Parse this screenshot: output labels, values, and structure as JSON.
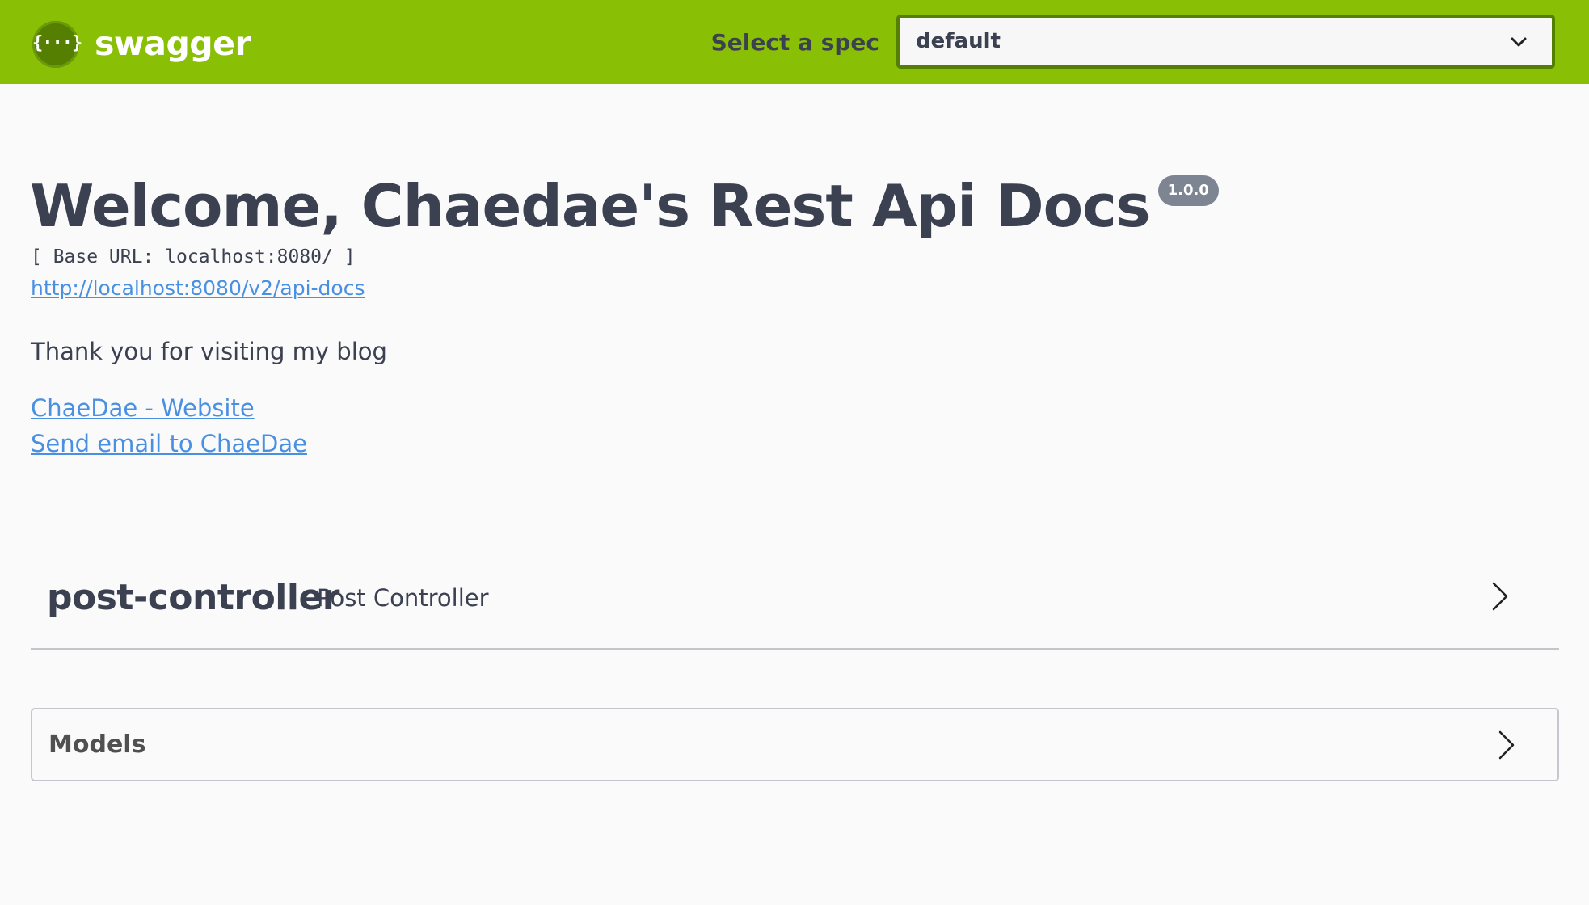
{
  "topbar": {
    "logo_glyph": "{···}",
    "logo_text": "swagger",
    "spec_label": "Select a spec",
    "spec_selected": "default",
    "colors": {
      "bar": "#89bf04",
      "select_border": "#547f00"
    }
  },
  "info": {
    "title": "Welcome, Chaedae's Rest Api Docs",
    "version": "1.0.0",
    "base_url": "[ Base URL: localhost:8080/ ]",
    "api_docs_link": "http://localhost:8080/v2/api-docs",
    "description": "Thank you for visiting my blog",
    "website_link": "ChaeDae - Website",
    "email_link": "Send email to ChaeDae",
    "link_color": "#4990e2"
  },
  "tags": [
    {
      "name": "post-controller",
      "description": "Post Controller",
      "icon": "chevron-right-icon"
    }
  ],
  "models": {
    "title": "Models",
    "icon": "chevron-right-icon"
  }
}
